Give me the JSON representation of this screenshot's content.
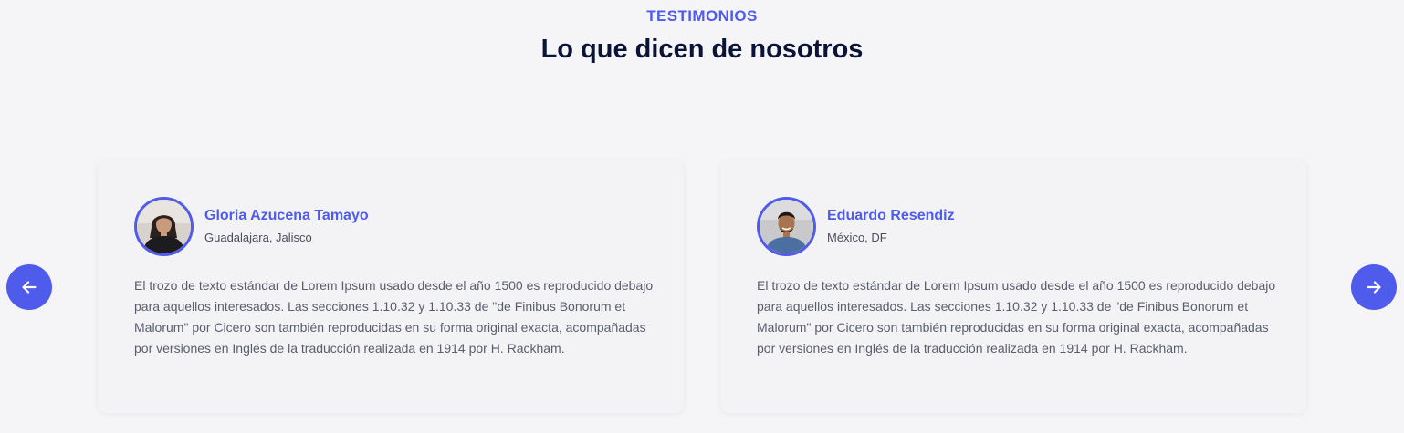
{
  "section": {
    "eyebrow": "TESTIMONIOS",
    "heading": "Lo que dicen de nosotros"
  },
  "testimonials": [
    {
      "name": "Gloria Azucena Tamayo",
      "location": "Guadalajara, Jalisco",
      "text": "El trozo de texto estándar de Lorem Ipsum usado desde el año 1500 es reproducido debajo para aquellos interesados. Las secciones 1.10.32 y 1.10.33 de \"de Finibus Bonorum et Malorum\" por Cicero son también reproducidas en su forma original exacta, acompañadas por versiones en Inglés de la traducción realizada en 1914 por H. Rackham."
    },
    {
      "name": "Eduardo Resendiz",
      "location": "México, DF",
      "text": "El trozo de texto estándar de Lorem Ipsum usado desde el año 1500 es reproducido debajo para aquellos interesados. Las secciones 1.10.32 y 1.10.33 de \"de Finibus Bonorum et Malorum\" por Cicero son también reproducidas en su forma original exacta, acompañadas por versiones en Inglés de la traducción realizada en 1914 por H. Rackham."
    }
  ],
  "navigation": {
    "prev_icon": "arrow-left-icon",
    "next_icon": "arrow-right-icon"
  },
  "colors": {
    "accent": "#4f5bea",
    "heading": "#0b1437",
    "background": "#f5f5f7",
    "card": "#f3f3f5"
  }
}
